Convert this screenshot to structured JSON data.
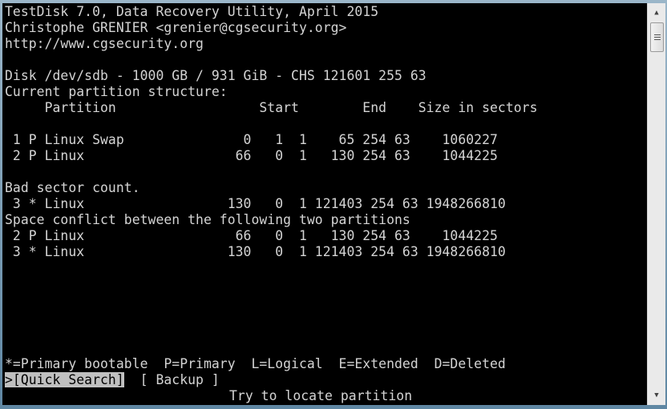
{
  "app": {
    "title": "TestDisk 7.0, Data Recovery Utility, April 2015",
    "author": "Christophe GRENIER <grenier@cgsecurity.org>",
    "url": "http://www.cgsecurity.org"
  },
  "disk": {
    "info": "Disk /dev/sdb - 1000 GB / 931 GiB - CHS 121601 255 63",
    "structure_heading": "Current partition structure:",
    "column_header": "     Partition                  Start        End    Size in sectors"
  },
  "partitions": [
    " 1 P Linux Swap               0   1  1    65 254 63    1060227",
    " 2 P Linux                   66   0  1   130 254 63    1044225"
  ],
  "messages": {
    "bad_sector": "Bad sector count.",
    "bad_partition": " 3 * Linux                  130   0  1 121403 254 63 1948266810",
    "conflict": "Space conflict between the following two partitions",
    "conflict_a": " 2 P Linux                   66   0  1   130 254 63    1044225",
    "conflict_b": " 3 * Linux                  130   0  1 121403 254 63 1948266810"
  },
  "legend": "*=Primary bootable  P=Primary  L=Logical  E=Extended  D=Deleted",
  "menu": {
    "quick_search": ">[Quick Search]",
    "backup": "[ Backup ]",
    "hint": "Try to locate partition"
  },
  "colors": {
    "background": "#000000",
    "foreground": "#d4d4d4",
    "highlight_bg": "#c0c0c0"
  }
}
